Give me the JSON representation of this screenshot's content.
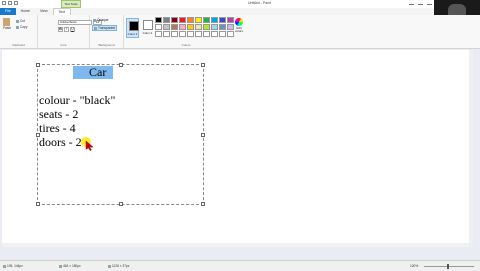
{
  "window": {
    "title": "Untitled - Paint"
  },
  "context_tab": "Text Tools",
  "tabs": [
    "File",
    "Home",
    "View",
    "Text"
  ],
  "ribbon": {
    "clipboard": {
      "paste": "Paste",
      "cut": "Cut",
      "copy": "Copy",
      "label": "Clipboard"
    },
    "font": {
      "family": "Adobe Bodo",
      "size": "12",
      "bold": "B",
      "italic": "I",
      "underline": "U",
      "label": "Font"
    },
    "background": {
      "opaque": "Opaque",
      "transparent": "Transparent",
      "label": "Background"
    },
    "colors": {
      "color1": "Color 1",
      "color2": "Color 2",
      "edit": "Edit colors",
      "label": "Colors"
    }
  },
  "palette": [
    "#000000",
    "#7f7f7f",
    "#880015",
    "#ed1c24",
    "#ff7f27",
    "#fff200",
    "#22b14c",
    "#00a2e8",
    "#3f48cc",
    "#a349a4",
    "#ffffff",
    "#c3c3c3",
    "#b97a57",
    "#ffaec9",
    "#ffc90e",
    "#efe4b0",
    "#b5e61d",
    "#99d9ea",
    "#7092be",
    "#c8bfe7",
    "#ffffff",
    "#ffffff",
    "#ffffff",
    "#ffffff",
    "#ffffff",
    "#ffffff",
    "#ffffff",
    "#ffffff",
    "#ffffff",
    "#ffffff"
  ],
  "canvas_text": {
    "title": "Car",
    "lines": [
      "colour - \"black\"",
      "seats - 2",
      "tires - 4",
      "doors - 2"
    ]
  },
  "status": {
    "cursor_pos": "105, 144px",
    "selection_size": "464 × 180px",
    "image_size": "1128 × 37px",
    "zoom": "100%"
  }
}
